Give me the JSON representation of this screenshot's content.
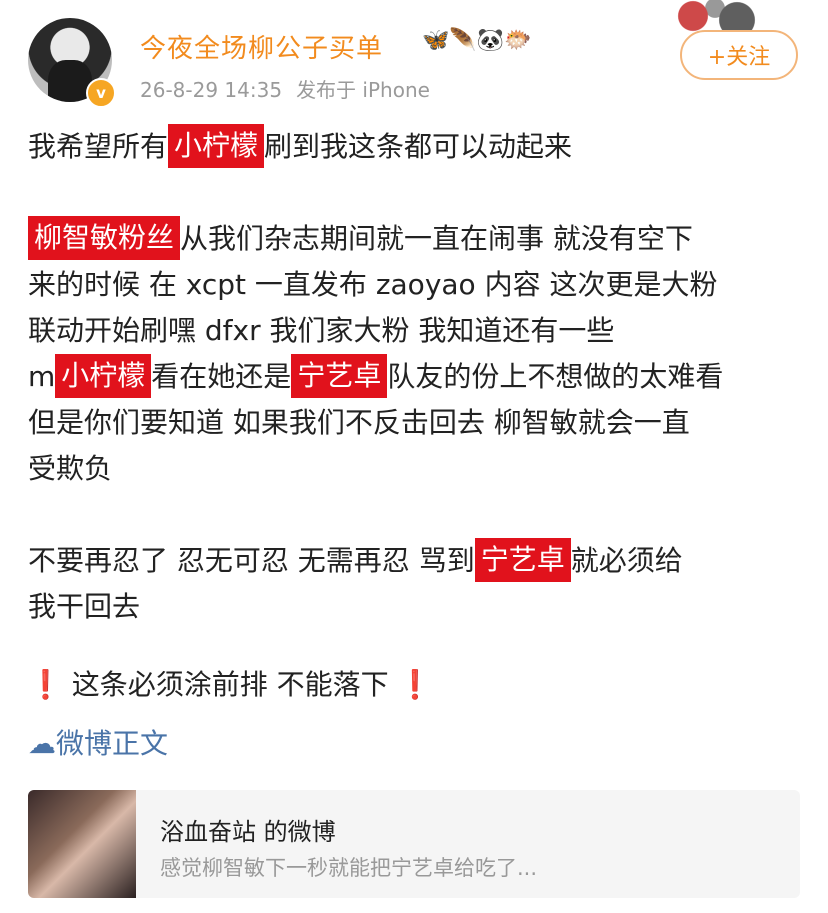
{
  "header": {
    "username": "今夜全场柳公子买单",
    "emojis": "🦋🪶🐼🐡",
    "timestamp": "26-8-29 14:35",
    "source": "发布于 iPhone",
    "verified_badge": "v",
    "follow_label": "+关注"
  },
  "post": {
    "lines": [
      [
        {
          "t": "我希望所有"
        },
        {
          "tag": "小柠檬"
        },
        {
          "t": "刷到我这条都可以动起来"
        }
      ],
      null,
      [
        {
          "tag": "柳智敏粉丝"
        },
        {
          "t": "从我们杂志期间就一直在闹事 就没有空下"
        }
      ],
      [
        {
          "t": "来的时候 在 xcpt 一直发布 zaoyao 内容 这次更是大粉"
        }
      ],
      [
        {
          "t": "联动开始刷嘿 dfxr 我们家大粉 我知道还有一些"
        }
      ],
      [
        {
          "t": "m"
        },
        {
          "tag": "小柠檬"
        },
        {
          "t": "看在她还是"
        },
        {
          "tag": "宁艺卓"
        },
        {
          "t": "队友的份上不想做的太难看"
        }
      ],
      [
        {
          "t": "但是你们要知道 如果我们不反击回去 柳智敏就会一直"
        }
      ],
      [
        {
          "t": "受欺负"
        }
      ],
      null,
      [
        {
          "t": "不要再忍了 忍无可忍 无需再忍 骂到"
        },
        {
          "tag": "宁艺卓"
        },
        {
          "t": "就必须给"
        }
      ],
      [
        {
          "t": "我干回去"
        }
      ],
      null,
      [
        {
          "excl": "❗"
        },
        {
          "t": " 这条必须涂前排 不能落下 "
        },
        {
          "excl": "❗"
        }
      ]
    ]
  },
  "weibo_link": "微博正文",
  "quote_card": {
    "title": "浴血奋站 的微博",
    "subtitle": "感觉柳智敏下一秒就能把宁艺卓给吃了..."
  },
  "colors": {
    "accent": "#f28b1e",
    "tag_red": "#e1121c",
    "link_blue": "#4a74a8"
  }
}
